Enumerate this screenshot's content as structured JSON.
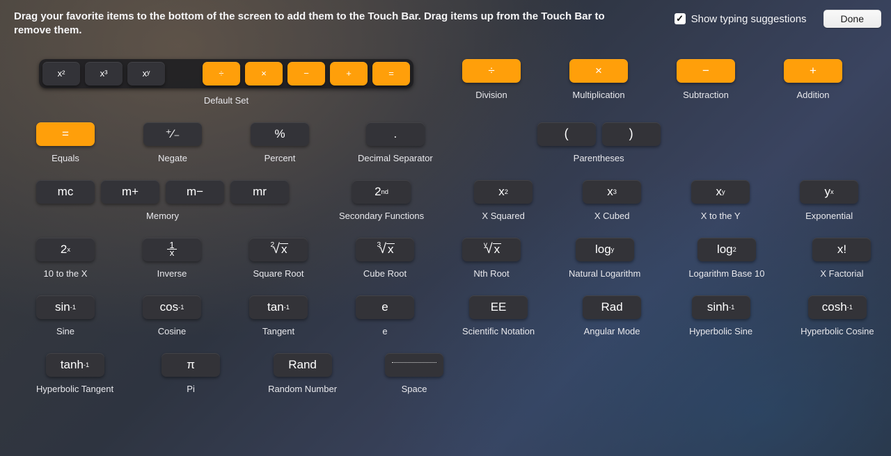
{
  "header": {
    "instructions": "Drag your favorite items to the bottom of the screen to add them to the Touch Bar. Drag items up from the Touch Bar to remove them.",
    "show_typing_label": "Show typing suggestions",
    "show_typing_checked": true,
    "done_label": "Done"
  },
  "rows": [
    {
      "items": [
        {
          "id": "default-set",
          "caption": "Default Set"
        },
        {
          "id": "division",
          "caption": "Division",
          "glyph": "÷"
        },
        {
          "id": "multiplication",
          "caption": "Multiplication",
          "glyph": "×"
        },
        {
          "id": "subtraction",
          "caption": "Subtraction",
          "glyph": "−"
        },
        {
          "id": "addition",
          "caption": "Addition",
          "glyph": "+"
        }
      ]
    },
    {
      "items": [
        {
          "id": "equals",
          "caption": "Equals",
          "glyph": "="
        },
        {
          "id": "negate",
          "caption": "Negate",
          "glyph": "⁺⁄₋"
        },
        {
          "id": "percent",
          "caption": "Percent",
          "glyph": "%"
        },
        {
          "id": "decimal",
          "caption": "Decimal Separator",
          "glyph": "."
        },
        {
          "id": "parentheses",
          "caption": "Parentheses",
          "left": "(",
          "right": ")"
        }
      ]
    },
    {
      "items": [
        {
          "id": "memory",
          "caption": "Memory",
          "keys": [
            "mc",
            "m+",
            "m−",
            "mr"
          ]
        },
        {
          "id": "secondary",
          "caption": "Secondary Functions",
          "html": "2<sup>nd</sup>"
        },
        {
          "id": "x-squared",
          "caption": "X Squared",
          "html": "x<sup>2</sup>"
        },
        {
          "id": "x-cubed",
          "caption": "X Cubed",
          "html": "x<sup>3</sup>"
        },
        {
          "id": "x-to-y",
          "caption": "X to the Y",
          "html": "x<sup>y</sup>"
        },
        {
          "id": "exponential",
          "caption": "Exponential",
          "html": "y<sup>x</sup>"
        }
      ]
    },
    {
      "items": [
        {
          "id": "10-to-x",
          "caption": "10 to the X",
          "html": "2<sup>x</sup>"
        },
        {
          "id": "inverse",
          "caption": "Inverse",
          "html": "<span style='display:inline-flex;flex-direction:column;align-items:center;line-height:0.8;font-size:13px'><span>1</span><span style='border-top:1.3px solid #fff;padding:0 4px'>x</span></span>"
        },
        {
          "id": "square-root",
          "caption": "Square Root",
          "root_deg": "2",
          "root_arg": "x"
        },
        {
          "id": "cube-root",
          "caption": "Cube Root",
          "root_deg": "3",
          "root_arg": "x"
        },
        {
          "id": "nth-root",
          "caption": "Nth Root",
          "root_deg": "y",
          "root_arg": "x"
        },
        {
          "id": "ln",
          "caption": "Natural Logarithm",
          "html": "log<sub>y</sub>"
        },
        {
          "id": "log10",
          "caption": "Logarithm Base 10",
          "html": "log<sub>2</sub>"
        },
        {
          "id": "factorial",
          "caption": "X Factorial",
          "glyph": "x!"
        }
      ]
    },
    {
      "items": [
        {
          "id": "sine",
          "caption": "Sine",
          "html": "sin<sup>-1</sup>"
        },
        {
          "id": "cosine",
          "caption": "Cosine",
          "html": "cos<sup>-1</sup>"
        },
        {
          "id": "tangent",
          "caption": "Tangent",
          "html": "tan<sup>-1</sup>"
        },
        {
          "id": "e-const",
          "caption": "e",
          "glyph": "e"
        },
        {
          "id": "ee",
          "caption": "Scientific Notation",
          "glyph": "EE"
        },
        {
          "id": "rad",
          "caption": "Angular Mode",
          "glyph": "Rad"
        },
        {
          "id": "sinh",
          "caption": "Hyperbolic Sine",
          "html": "sinh<sup>-1</sup>"
        },
        {
          "id": "cosh",
          "caption": "Hyperbolic Cosine",
          "html": "cosh<sup>-1</sup>"
        }
      ]
    },
    {
      "items": [
        {
          "id": "tanh",
          "caption": "Hyperbolic Tangent",
          "html": "tanh<sup>-1</sup>"
        },
        {
          "id": "pi",
          "caption": "Pi",
          "glyph": "π"
        },
        {
          "id": "rand",
          "caption": "Random Number",
          "glyph": "Rand"
        },
        {
          "id": "space",
          "caption": "Space"
        }
      ]
    }
  ],
  "default_set": {
    "powers": [
      "x²",
      "x³",
      "xʸ"
    ],
    "ops": [
      "÷",
      "×",
      "−",
      "+",
      "="
    ]
  }
}
